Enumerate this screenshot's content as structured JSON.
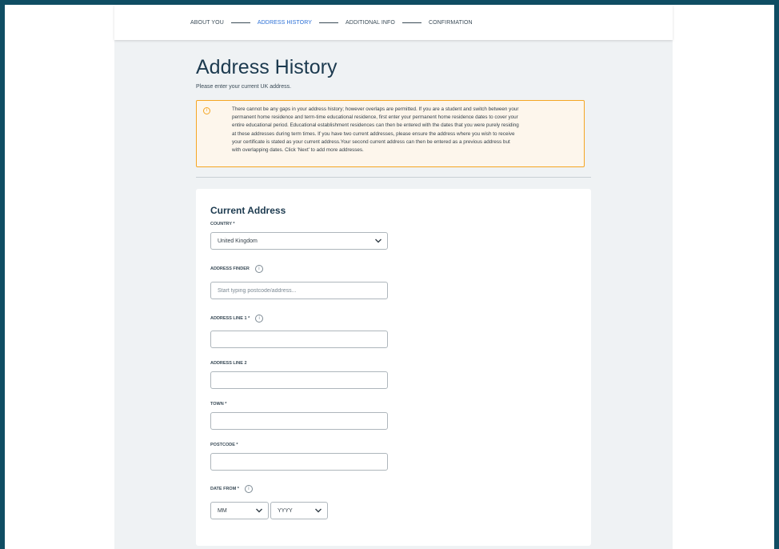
{
  "stepper": {
    "steps": [
      "ABOUT YOU",
      "ADDRESS HISTORY",
      "ADDITIONAL INFO",
      "CONFIRMATION"
    ]
  },
  "page": {
    "title": "Address History",
    "subtitle": "Please enter your current UK address."
  },
  "notice": {
    "icon": "info-icon",
    "lines": [
      "There cannot be any gaps in your address history; however overlaps are permitted. If you are a student and switch between your",
      "permanent home residence and term-time educational residence, first enter your permanent home residence dates to cover your",
      "entire educational period. Educational establishment residences can then be entered with the dates that you were purely residing",
      "at these addresses during term times. If you have two current addresses, please ensure the address where you wish to receive",
      "your certificate is stated as your current address.Your second current address can then be entered as a previous address but",
      "with overlapping dates. Click 'Next' to add more addresses."
    ]
  },
  "form": {
    "title": "Current Address",
    "country_label": "COUNTRY *",
    "country_value": "United Kingdom",
    "finder_label": "ADDRESS FINDER",
    "finder_placeholder": "Start typing postcode/address...",
    "line1_label": "ADDRESS LINE 1 *",
    "line2_label": "ADDRESS LINE 2",
    "town_label": "TOWN *",
    "postcode_label": "POSTCODE *",
    "date_from_label": "DATE FROM *",
    "month_value": "MM",
    "year_value": "YYYY"
  },
  "colors": {
    "frame": "#0f4d63",
    "active_step": "#2a6fd6",
    "notice_border": "#f5a623",
    "title": "#1c3a4f"
  }
}
